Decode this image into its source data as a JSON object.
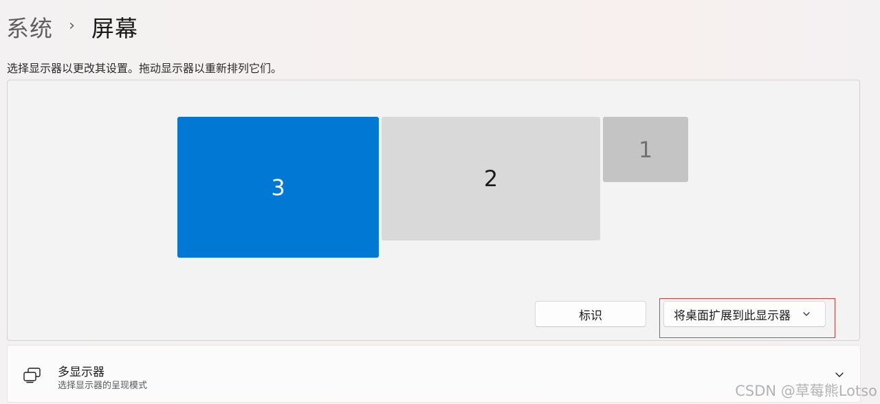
{
  "breadcrumb": {
    "parent": "系统",
    "separator": "›",
    "current": "屏幕"
  },
  "description": "选择显示器以更改其设置。拖动显示器以重新排列它们。",
  "monitors": [
    {
      "label": "3",
      "selected": true,
      "color": "#0078d4"
    },
    {
      "label": "2",
      "selected": false,
      "color": "#d9d9d9"
    },
    {
      "label": "1",
      "selected": false,
      "color": "#c4c4c4"
    }
  ],
  "buttons": {
    "identify_label": "标识",
    "extend_label": "将桌面扩展到此显示器",
    "extend_icon": "chevron-down-icon"
  },
  "multi_display": {
    "icon": "multiple-displays-icon",
    "title": "多显示器",
    "subtitle": "选择显示器的呈现模式",
    "expand_icon": "chevron-down-icon"
  },
  "watermark": "CSDN @草莓熊Lotso",
  "colors": {
    "accent": "#0078d4",
    "highlight": "#e33a3a"
  }
}
